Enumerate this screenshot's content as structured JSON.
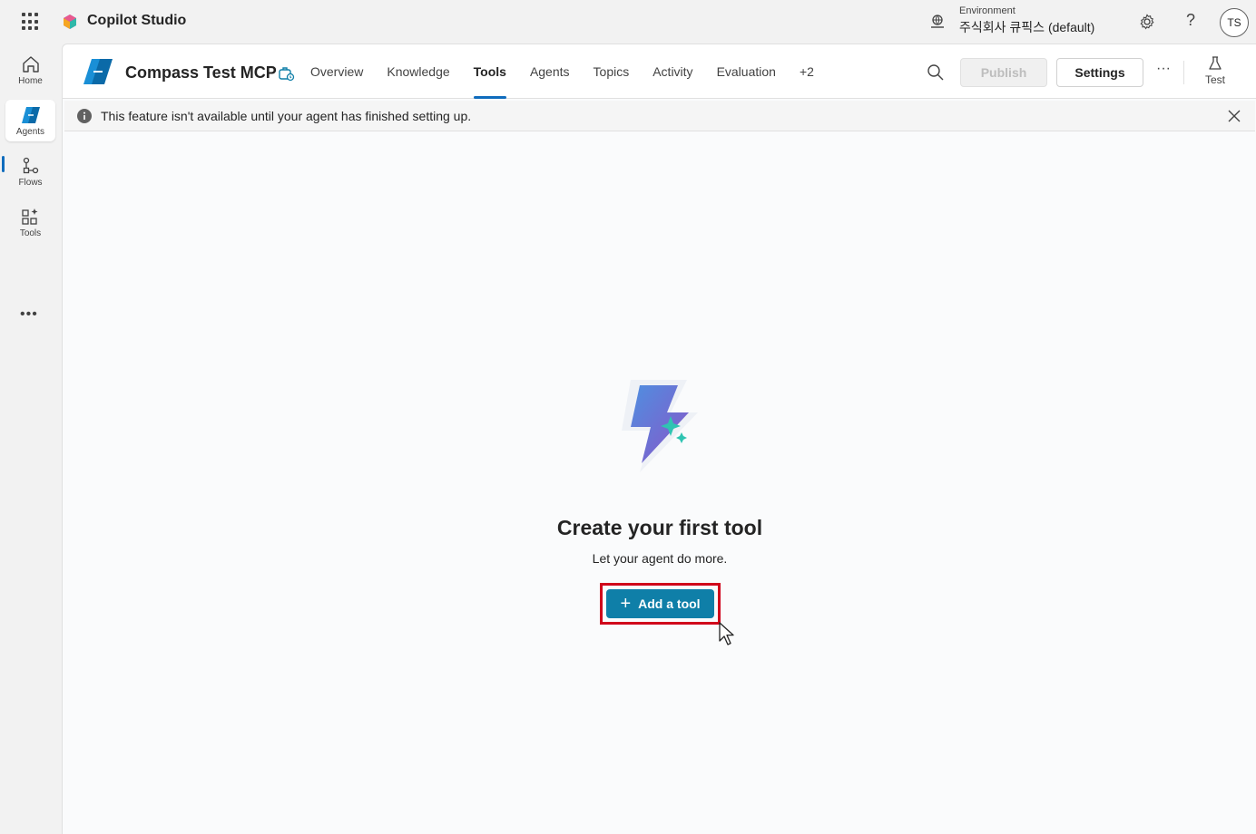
{
  "app": {
    "title": "Copilot Studio",
    "environment_label": "Environment",
    "environment_value": "주식회사 큐픽스 (default)",
    "avatar_initials": "TS",
    "help_glyph": "?"
  },
  "rail": {
    "items": [
      {
        "label": "Home",
        "icon": "home-icon"
      },
      {
        "label": "Agents",
        "icon": "agents-icon"
      },
      {
        "label": "Flows",
        "icon": "flows-icon"
      },
      {
        "label": "Tools",
        "icon": "tools-icon"
      }
    ],
    "active": "Agents",
    "more_glyph": "•••"
  },
  "agent": {
    "name": "Compass Test MCP"
  },
  "tabs": [
    {
      "label": "Overview"
    },
    {
      "label": "Knowledge"
    },
    {
      "label": "Tools"
    },
    {
      "label": "Agents"
    },
    {
      "label": "Topics"
    },
    {
      "label": "Activity"
    },
    {
      "label": "Evaluation"
    },
    {
      "label": "+2"
    }
  ],
  "active_tab": "Tools",
  "toolbar": {
    "publish_label": "Publish",
    "settings_label": "Settings",
    "more_glyph": "···",
    "test_label": "Test"
  },
  "notice": {
    "text": "This feature isn't available until your agent has finished setting up."
  },
  "empty_state": {
    "title": "Create your first tool",
    "subtitle": "Let your agent do more.",
    "button_label": "Add a tool",
    "button_plus": "+"
  },
  "colors": {
    "accent": "#0f6cbd",
    "primary_button": "#0f7fa8",
    "highlight_box": "#d0021b"
  }
}
